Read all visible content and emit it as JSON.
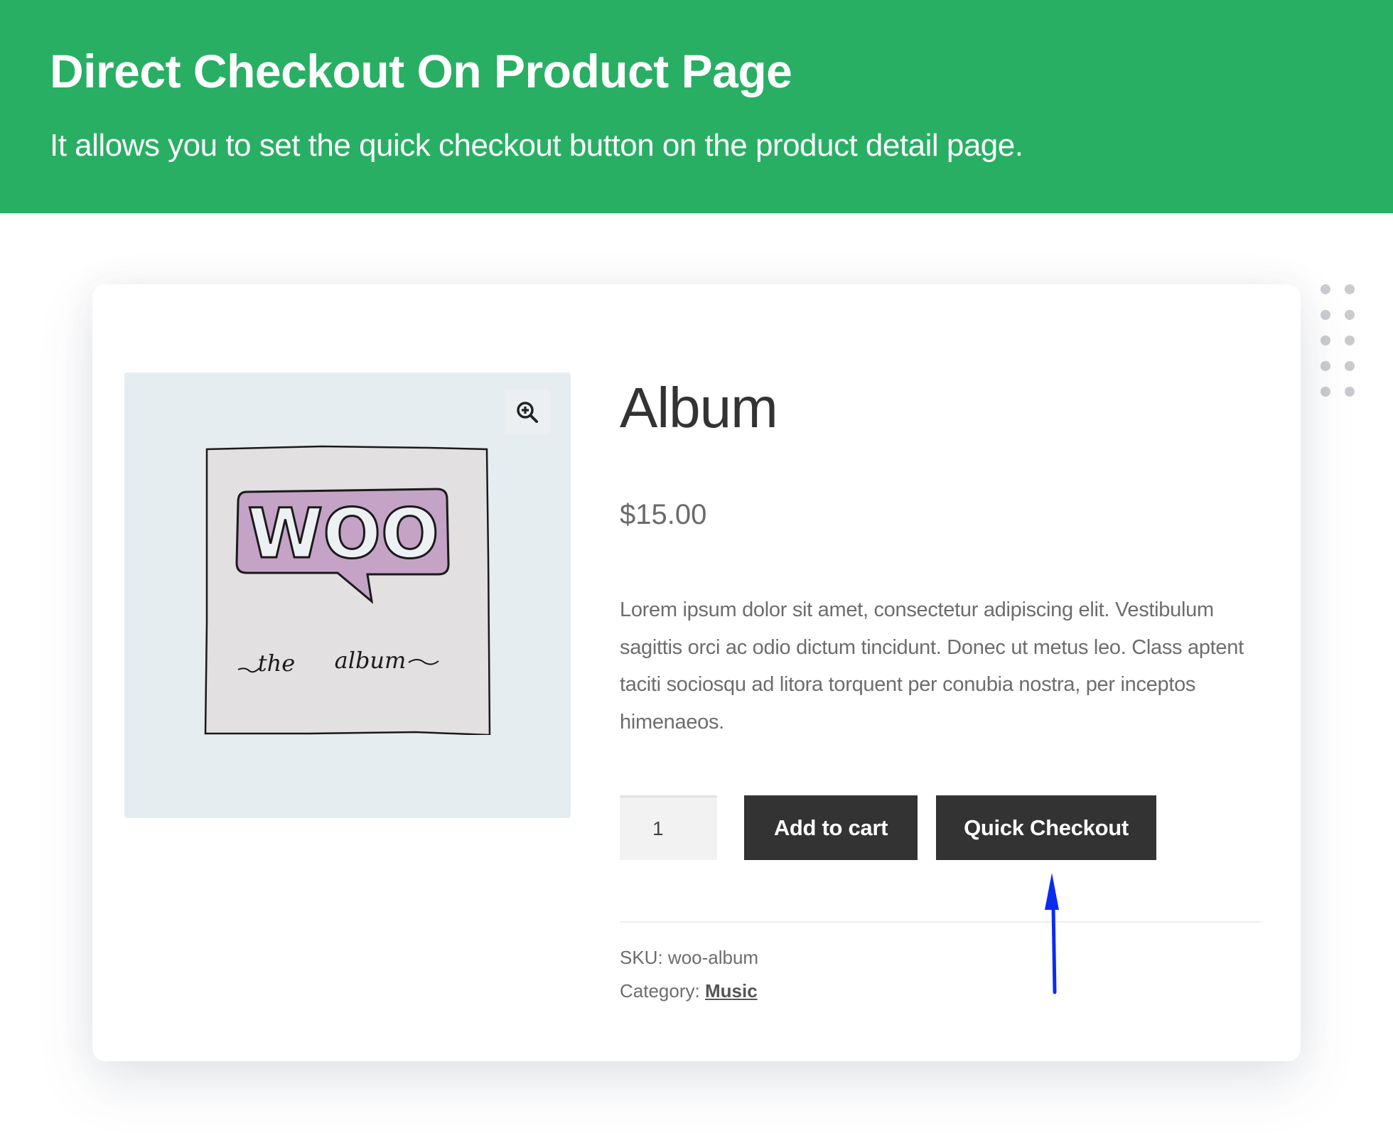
{
  "banner": {
    "title": "Direct Checkout On Product Page",
    "subtitle": "It allows you to set the quick checkout button on the product detail page.",
    "background_color": "#28af63"
  },
  "product": {
    "image": {
      "alt": "Woo the album cover",
      "speech_bubble_text": "WOO",
      "caption_left": "the",
      "caption_right": "album",
      "zoom_icon": "zoom-in-icon"
    },
    "title": "Album",
    "price": "$15.00",
    "description": "Lorem ipsum dolor sit amet, consectetur adipiscing elit. Vestibulum sagittis orci ac odio dictum tincidunt. Donec ut metus leo. Class aptent taciti sociosqu ad litora torquent per conubia nostra, per inceptos himenaeos.",
    "quantity": "1",
    "add_to_cart_label": "Add to cart",
    "quick_checkout_label": "Quick Checkout",
    "sku_label": "SKU:",
    "sku_value": "woo-album",
    "category_label": "Category:",
    "category_value": "Music"
  },
  "annotation": {
    "arrow_color": "#0a2cf0",
    "target": "Quick Checkout"
  },
  "colors": {
    "button_bg": "#333333",
    "image_bg": "#e6edf0",
    "speech_bubble": "#c4a3c6"
  }
}
